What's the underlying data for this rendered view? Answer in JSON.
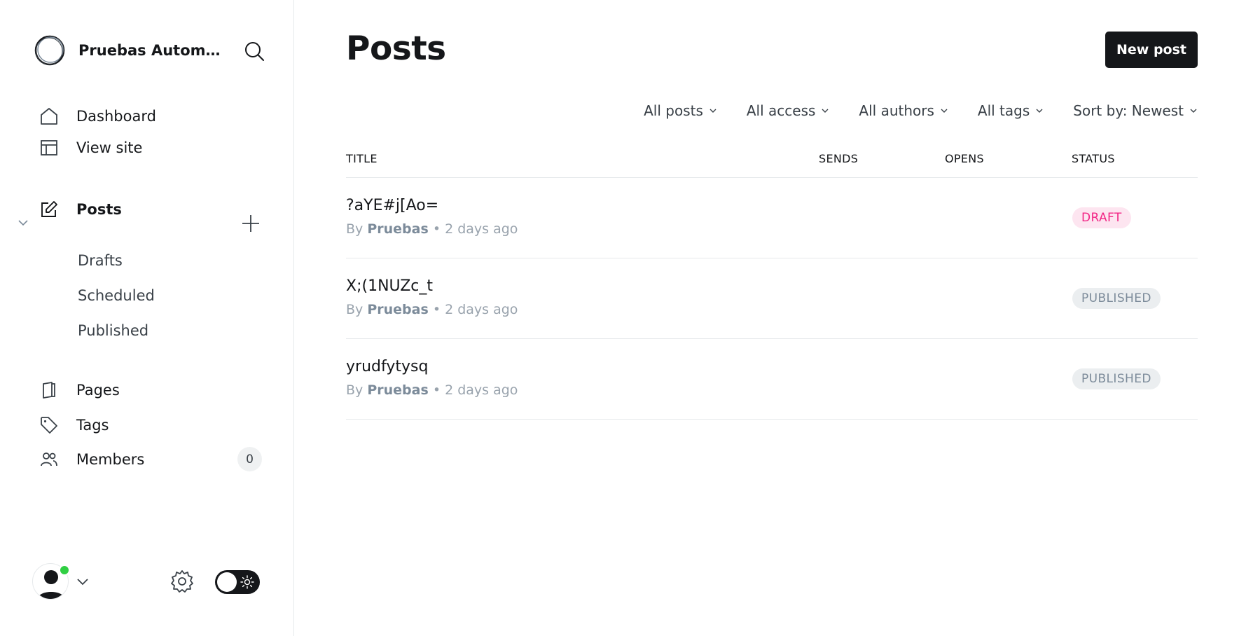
{
  "sidebar": {
    "brand_title": "Pruebas Automatizadas",
    "nav_top": [
      {
        "label": "Dashboard",
        "icon": "home-icon"
      },
      {
        "label": "View site",
        "icon": "layout-icon"
      }
    ],
    "posts": {
      "label": "Posts",
      "icon": "edit-icon",
      "sub_items": [
        "Drafts",
        "Scheduled",
        "Published"
      ]
    },
    "nav_bottom": [
      {
        "label": "Pages",
        "icon": "page-icon"
      },
      {
        "label": "Tags",
        "icon": "tag-icon"
      },
      {
        "label": "Members",
        "icon": "members-icon"
      }
    ],
    "members_count": "0"
  },
  "main": {
    "title": "Posts",
    "new_post_label": "New post",
    "filters": [
      "All posts",
      "All access",
      "All authors",
      "All tags",
      "Sort by: Newest"
    ],
    "columns": {
      "title": "TITLE",
      "sends": "SENDS",
      "opens": "OPENS",
      "status": "STATUS"
    },
    "rows": [
      {
        "title": "?aYE#j[Ao=",
        "by": "By ",
        "author": "Pruebas",
        "time": " • 2 days ago",
        "status": "DRAFT",
        "status_type": "draft"
      },
      {
        "title": "X;(1NUZc_t",
        "by": "By ",
        "author": "Pruebas",
        "time": " • 2 days ago",
        "status": "PUBLISHED",
        "status_type": "published"
      },
      {
        "title": "yrudfytysq",
        "by": "By ",
        "author": "Pruebas",
        "time": " • 2 days ago",
        "status": "PUBLISHED",
        "status_type": "published"
      }
    ]
  },
  "colors": {
    "accent_dark": "#15171a",
    "draft_bg": "#fde5f0",
    "draft_text": "#f22585",
    "published_bg": "#ebeef0",
    "published_text": "#7c8b9a",
    "online": "#30cf43"
  }
}
